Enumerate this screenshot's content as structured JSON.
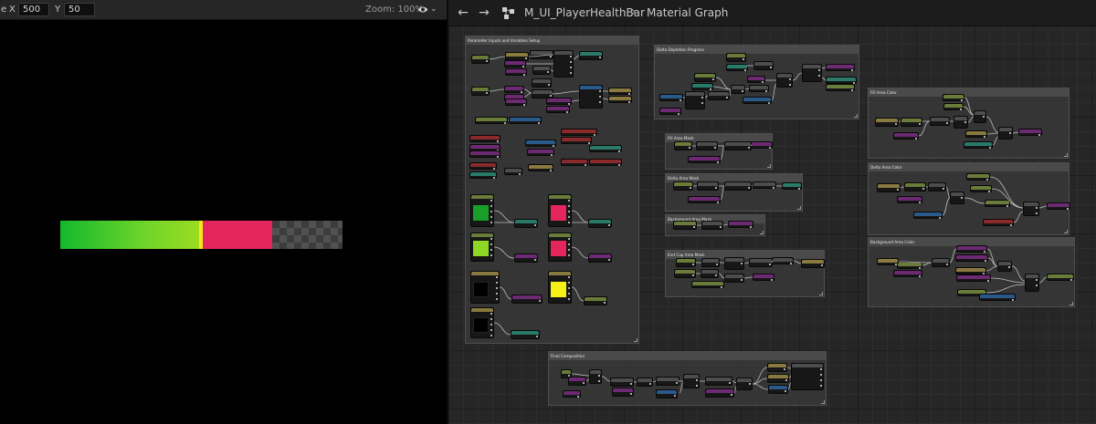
{
  "preview": {
    "x_cut_label": "e",
    "x_label": "X",
    "x_value": "500",
    "y_label": "Y",
    "y_value": "50",
    "zoom_text": "Zoom: 100%",
    "healthbar": {
      "health_fraction": 0.5,
      "delta_fraction": 0.25,
      "colors": {
        "fill_start": "#15b82d",
        "fill_end": "#9ddc21",
        "end_cap": "#f6e818",
        "delta": "#e5265c",
        "background_checker": "#3c3c3c"
      }
    }
  },
  "graph": {
    "back_icon": "arrow-left-icon",
    "forward_icon": "arrow-right-icon",
    "graph_icon": "graph-nodes-icon",
    "asset_name": "M_UI_PlayerHealthBar",
    "separator": "›",
    "graph_name": "Material Graph",
    "comments": [
      {
        "id": "params",
        "title": "Parameter Inputs and Variables Setup"
      },
      {
        "id": "delta-depletion",
        "title": "Delta Depletion Progress"
      },
      {
        "id": "fill-color",
        "title": "Fill Area Color"
      },
      {
        "id": "fill-mask",
        "title": "Fill Area Mask"
      },
      {
        "id": "delta-mask",
        "title": "Delta Area Mask"
      },
      {
        "id": "delta-color",
        "title": "Delta Area Color"
      },
      {
        "id": "bg-mask",
        "title": "Background Area Mask"
      },
      {
        "id": "endcap-mask",
        "title": "End Cap Area Mask"
      },
      {
        "id": "bg-color",
        "title": "Background Area Color"
      },
      {
        "id": "final",
        "title": "Final Composition"
      }
    ],
    "swatch_colors": [
      "#1a9e2a",
      "#e5265c",
      "#8fd726",
      "#e5265c",
      "#000000",
      "#f6f018",
      "#000000"
    ],
    "node_header_colors": {
      "scalar": "#6a7c3a",
      "vector": "#8a7a40",
      "math": "#4d4d4d",
      "param": "#6b2a72",
      "texture": "#2a5a8a",
      "teal": "#2a7a6a",
      "red": "#8a2a2a"
    }
  }
}
